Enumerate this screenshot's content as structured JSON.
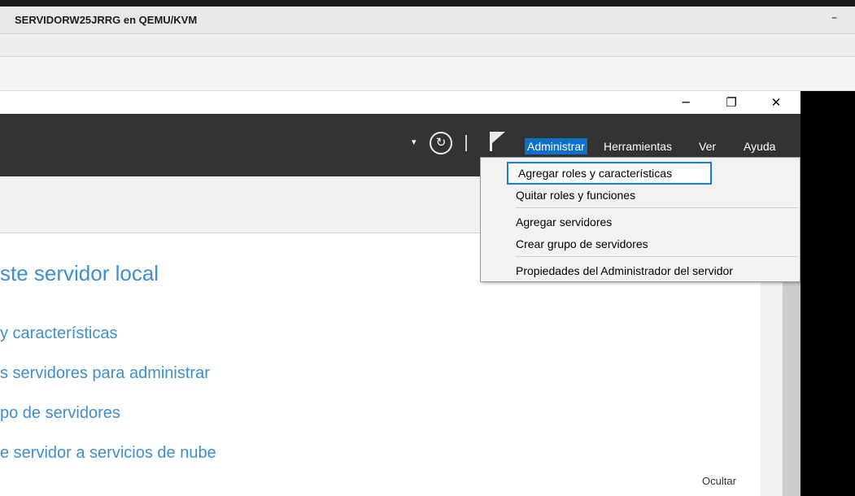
{
  "vm": {
    "title": "SERVIDORW25JRRG en QEMU/KVM",
    "minimize_glyph": "–"
  },
  "window_controls": {
    "minimize": "─",
    "restore": "❐",
    "close": "✕"
  },
  "menubar": {
    "dropdown_glyph": "▾",
    "refresh_glyph": "↻",
    "items": [
      {
        "label": "Administrar",
        "active": true
      },
      {
        "label": "Herramientas"
      },
      {
        "label": "Ver"
      },
      {
        "label": "Ayuda"
      }
    ]
  },
  "admin_menu": {
    "items": [
      {
        "label": "Agregar roles y características"
      },
      {
        "label": "Quitar roles y funciones"
      },
      {
        "label": "Agregar servidores"
      },
      {
        "label": "Crear grupo de servidores"
      },
      {
        "label": "Propiedades del Administrador del servidor"
      }
    ]
  },
  "main": {
    "heading": "ste servidor local",
    "links": [
      "y características",
      "s servidores para administrar",
      "po de servidores",
      "e servidor a servicios de nube"
    ],
    "hide_label": "Ocultar"
  },
  "colors": {
    "accent": "#0e70c8",
    "link": "#3d8fd1",
    "menubar_bg": "#333333"
  }
}
